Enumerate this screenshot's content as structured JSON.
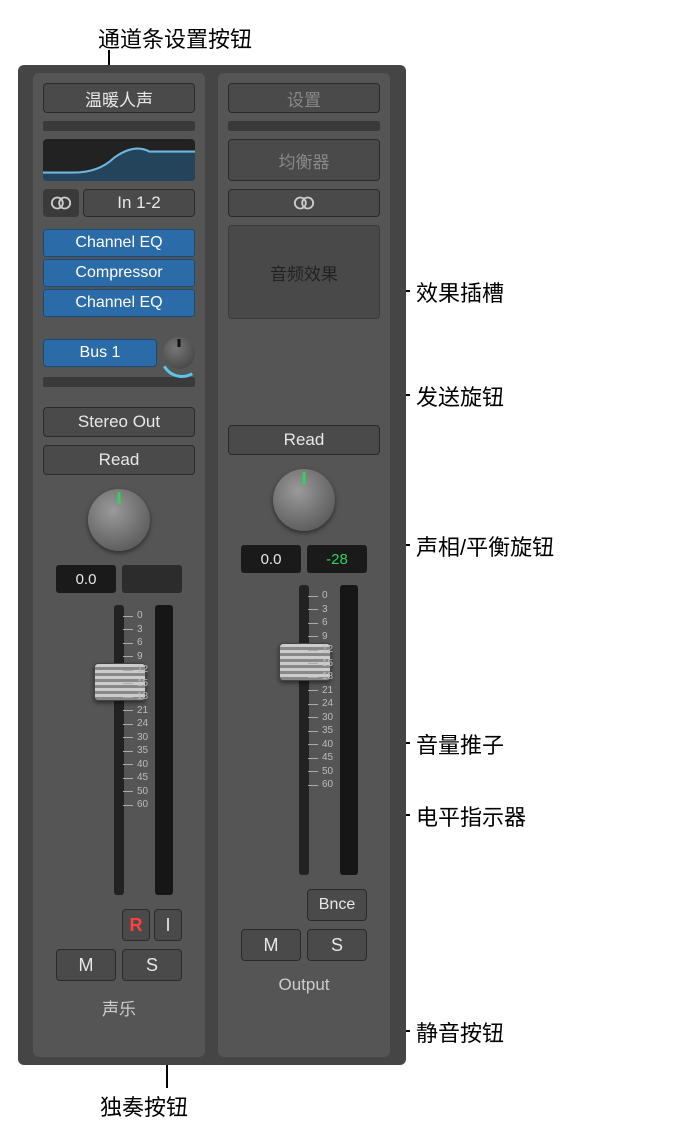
{
  "callouts": {
    "channel_strip_settings": "通道条设置按钮",
    "effect_slots": "效果插槽",
    "send_knob": "发送旋钮",
    "pan_knob": "声相/平衡旋钮",
    "volume_fader": "音量推子",
    "level_indicator": "电平指示器",
    "mute_button": "静音按钮",
    "solo_button": "独奏按钮"
  },
  "channel_left": {
    "setting_label": "温暖人声",
    "input_label": "In 1-2",
    "effects": [
      "Channel EQ",
      "Compressor",
      "Channel EQ"
    ],
    "send_label": "Bus 1",
    "output_label": "Stereo Out",
    "automation_label": "Read",
    "pan_value": "0.0",
    "second_readout": "",
    "record_label": "R",
    "input_mon_label": "I",
    "mute_label": "M",
    "solo_label": "S",
    "track_name": "声乐",
    "meter_scale": [
      "0",
      "3",
      "6",
      "9",
      "12",
      "15",
      "18",
      "21",
      "24",
      "30",
      "35",
      "40",
      "45",
      "50",
      "60"
    ]
  },
  "channel_right": {
    "setting_label": "设置",
    "eq_label": "均衡器",
    "fx_label": "音频效果",
    "automation_label": "Read",
    "pan_value": "0.0",
    "peak_value": "-28",
    "bounce_label": "Bnce",
    "mute_label": "M",
    "solo_label": "S",
    "track_name": "Output",
    "meter_scale": [
      "0",
      "3",
      "6",
      "9",
      "12",
      "15",
      "18",
      "21",
      "24",
      "30",
      "35",
      "40",
      "45",
      "50",
      "60"
    ]
  }
}
